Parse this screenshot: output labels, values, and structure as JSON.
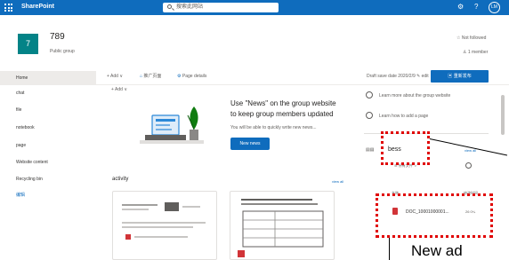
{
  "topbar": {
    "app_name": "SharePoint",
    "search_placeholder": "搜索此网站",
    "user_initials": "LM",
    "gear": "⚙",
    "help": "?"
  },
  "site": {
    "title": "789",
    "subtitle": "Public group",
    "logo_letter": "7",
    "follow_status": "☆ Not followed",
    "members": "1 member"
  },
  "nav": {
    "items": [
      "Home",
      "chat",
      "file",
      "notebook",
      "page",
      "Website content",
      "Recycling bin",
      "编辑"
    ]
  },
  "commandbar": {
    "new_label": "+ Add ∨",
    "promote_label": "推广页面",
    "details_label": "Page details",
    "draft_saved": "Draft save date 2020/2/9",
    "edit_label": "edit",
    "publish_label": "重新发布"
  },
  "content": {
    "add_section": "+ Add ∨"
  },
  "news": {
    "title_line1": "Use \"News\" on the group website",
    "title_line2": "to keep group members updated",
    "description": "You will be able to quickly write new news...",
    "button_label": "New news"
  },
  "activity": {
    "title": "activity",
    "view_all": "view all"
  },
  "right_panel": {
    "links": [
      "Learn more about the group website",
      "Learn how to add a page"
    ],
    "library_name": "bess",
    "view_all": "view all",
    "all_files": "所有文件 ∨",
    "col_name": "名称",
    "col_modified": "修改时间",
    "file_name": "DOC_10001000001...",
    "file_date": "26 0¼"
  },
  "annotation": {
    "callout": "N",
    "callout_rest": "ew ad"
  }
}
